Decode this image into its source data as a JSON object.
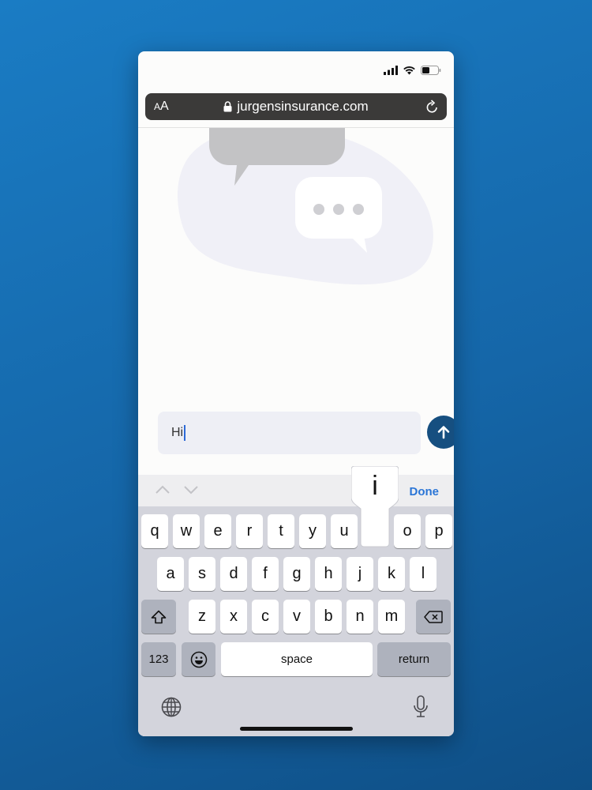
{
  "browser": {
    "text_size_label": "AA",
    "url": "jurgensinsurance.com"
  },
  "chat": {
    "input_value": "Hi"
  },
  "accessory_bar": {
    "done_label": "Done"
  },
  "keyboard": {
    "row1": [
      "q",
      "w",
      "e",
      "r",
      "t",
      "y",
      "u",
      "i",
      "o",
      "p"
    ],
    "row2": [
      "a",
      "s",
      "d",
      "f",
      "g",
      "h",
      "j",
      "k",
      "l"
    ],
    "row3": [
      "z",
      "x",
      "c",
      "v",
      "b",
      "n",
      "m"
    ],
    "numbers_label": "123",
    "space_label": "space",
    "return_label": "return",
    "pressed_key": "i"
  },
  "colors": {
    "background": "#1566a8",
    "send_button": "#164f80",
    "accent": "#2a75d6"
  }
}
